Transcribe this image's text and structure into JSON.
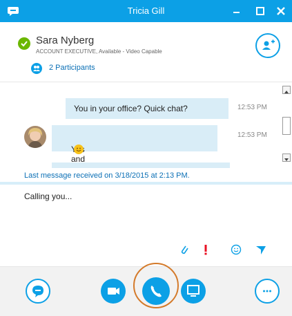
{
  "window": {
    "title": "Tricia Gill",
    "accent": "#0ca0e6"
  },
  "contact": {
    "name": "Sara Nyberg",
    "subtitle": "ACCOUNT EXECUTIVE, Available - Video Capable",
    "status_color": "#6bb700",
    "participants_label": "2 Participants"
  },
  "messages": [
    {
      "text": "You in your office? Quick chat?",
      "time": "12:53 PM"
    },
    {
      "text": "Yes and yes",
      "time": "12:53 PM",
      "emoji": "smile-emoji"
    }
  ],
  "last_message_notice": "Last message received on 3/18/2015 at 2:13 PM.",
  "compose": {
    "value": "Calling you..."
  },
  "compose_tools": [
    "paperclip-icon",
    "exclamation-icon",
    "smiley-icon",
    "send-icon"
  ],
  "bottom_bar": [
    "im-icon",
    "video-icon",
    "phone-icon",
    "present-icon",
    "more-icon"
  ],
  "highlight_color": "#d47a2a"
}
